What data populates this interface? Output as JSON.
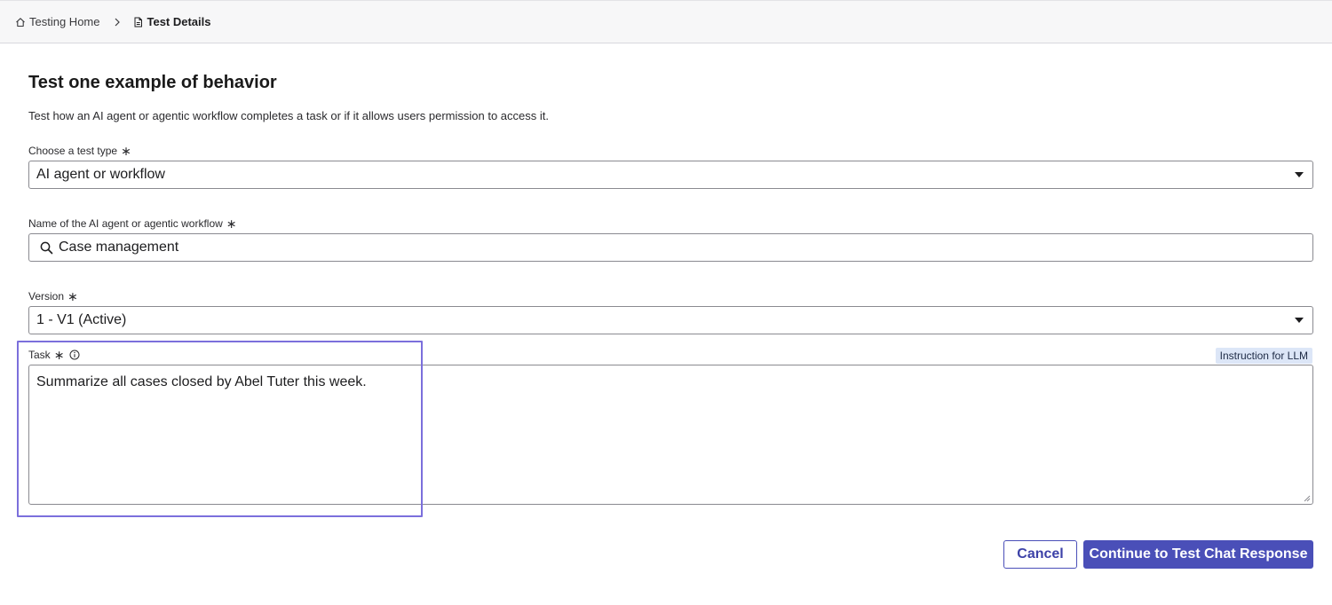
{
  "breadcrumb": {
    "home_label": "Testing Home",
    "current_label": "Test Details"
  },
  "page": {
    "title": "Test one example of behavior",
    "description": "Test how an AI agent or agentic workflow completes a task or if it allows users permission to access it."
  },
  "fields": {
    "test_type": {
      "label": "Choose a test type",
      "value": "AI agent or workflow"
    },
    "agent_name": {
      "label": "Name of the AI agent or agentic workflow",
      "value": "Case management"
    },
    "version": {
      "label": "Version",
      "value": "1 - V1 (Active)"
    },
    "task": {
      "label": "Task",
      "value": "Summarize all cases closed by Abel Tuter this week.",
      "badge": "Instruction for LLM"
    }
  },
  "required_mark": "∗",
  "actions": {
    "cancel_label": "Cancel",
    "continue_label": "Continue to Test Chat Response"
  },
  "colors": {
    "primary": "#4a4fb8",
    "highlight": "#7b6fdc",
    "badge_bg": "#dce6f7"
  }
}
